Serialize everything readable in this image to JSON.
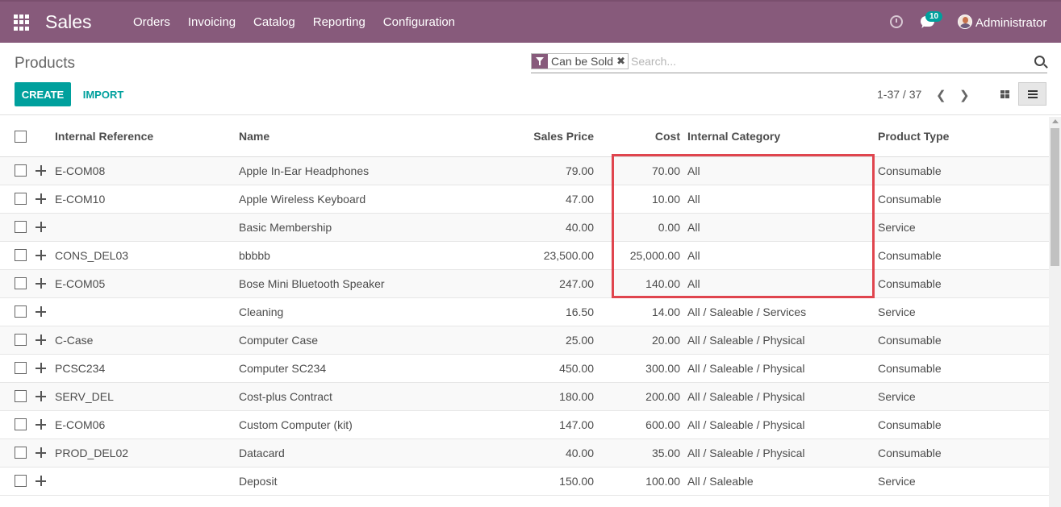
{
  "header": {
    "app_name": "Sales",
    "menu": [
      "Orders",
      "Invoicing",
      "Catalog",
      "Reporting",
      "Configuration"
    ],
    "notification_count": "10",
    "user": "Administrator"
  },
  "control": {
    "title": "Products",
    "facet_label": "Can be Sold",
    "facet_close": "✖",
    "search_placeholder": "Search...",
    "create_label": "CREATE",
    "import_label": "IMPORT",
    "pager": "1-37 / 37",
    "pager_prev": "❮",
    "pager_next": "❯"
  },
  "table": {
    "columns": [
      "Internal Reference",
      "Name",
      "Sales Price",
      "Cost",
      "Internal Category",
      "Product Type"
    ],
    "rows": [
      {
        "ref": "E-COM08",
        "name": "Apple In-Ear Headphones",
        "price": "79.00",
        "cost": "70.00",
        "category": "All",
        "type": "Consumable"
      },
      {
        "ref": "E-COM10",
        "name": "Apple Wireless Keyboard",
        "price": "47.00",
        "cost": "10.00",
        "category": "All",
        "type": "Consumable"
      },
      {
        "ref": "",
        "name": "Basic Membership",
        "price": "40.00",
        "cost": "0.00",
        "category": "All",
        "type": "Service"
      },
      {
        "ref": "CONS_DEL03",
        "name": "bbbbb",
        "price": "23,500.00",
        "cost": "25,000.00",
        "category": "All",
        "type": "Consumable"
      },
      {
        "ref": "E-COM05",
        "name": "Bose Mini Bluetooth Speaker",
        "price": "247.00",
        "cost": "140.00",
        "category": "All",
        "type": "Consumable"
      },
      {
        "ref": "",
        "name": "Cleaning",
        "price": "16.50",
        "cost": "14.00",
        "category": "All / Saleable / Services",
        "type": "Service"
      },
      {
        "ref": "C-Case",
        "name": "Computer Case",
        "price": "25.00",
        "cost": "20.00",
        "category": "All / Saleable / Physical",
        "type": "Consumable"
      },
      {
        "ref": "PCSC234",
        "name": "Computer SC234",
        "price": "450.00",
        "cost": "300.00",
        "category": "All / Saleable / Physical",
        "type": "Consumable"
      },
      {
        "ref": "SERV_DEL",
        "name": "Cost-plus Contract",
        "price": "180.00",
        "cost": "200.00",
        "category": "All / Saleable / Physical",
        "type": "Service"
      },
      {
        "ref": "E-COM06",
        "name": "Custom Computer (kit)",
        "price": "147.00",
        "cost": "600.00",
        "category": "All / Saleable / Physical",
        "type": "Consumable"
      },
      {
        "ref": "PROD_DEL02",
        "name": "Datacard",
        "price": "40.00",
        "cost": "35.00",
        "category": "All / Saleable / Physical",
        "type": "Consumable"
      },
      {
        "ref": "",
        "name": "Deposit",
        "price": "150.00",
        "cost": "100.00",
        "category": "All / Saleable",
        "type": "Service"
      }
    ]
  },
  "colors": {
    "brand": "#875a7b",
    "primary": "#00a09d",
    "highlight": "#e0454e"
  }
}
